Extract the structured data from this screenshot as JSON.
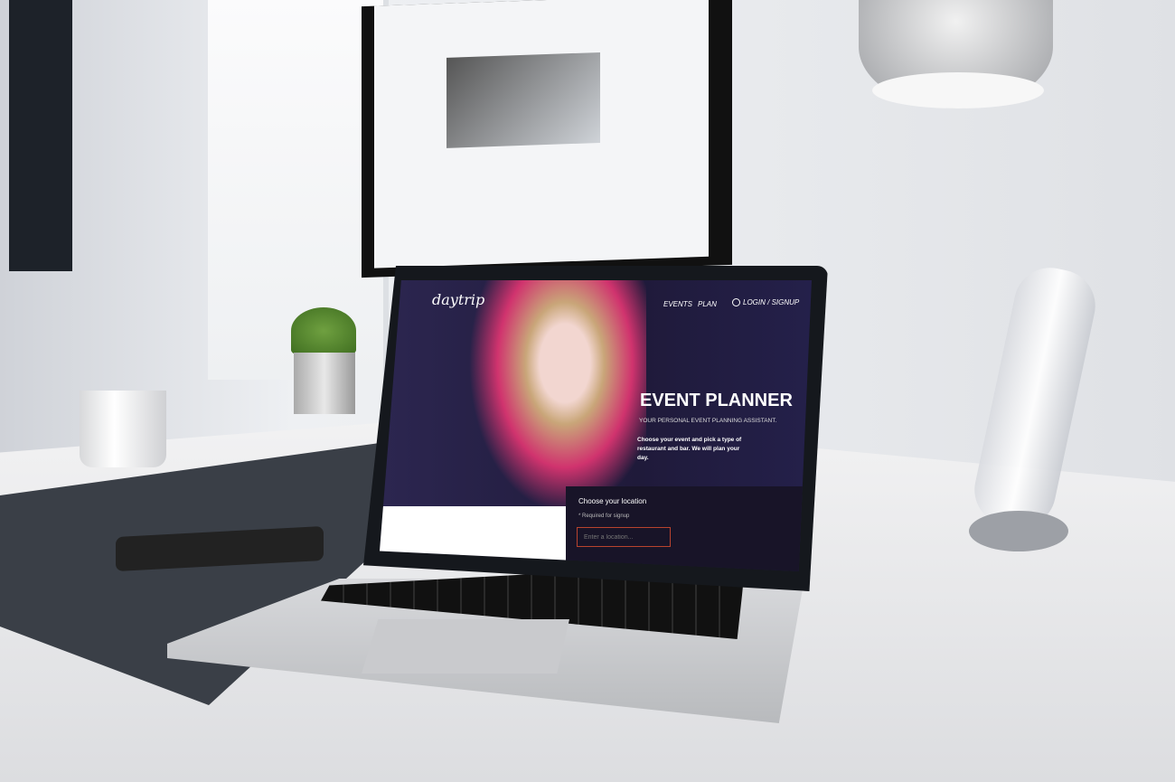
{
  "site": {
    "logo": "daytrip",
    "nav": {
      "events": "EVENTS",
      "plan": "PLAN",
      "login": "LOGIN / SIGNUP"
    },
    "hero": {
      "title": "EVENT PLANNER",
      "subtitle": "YOUR PERSONAL EVENT PLANNING ASSISTANT.",
      "description": "Choose your event and pick a type of restaurant and bar. We will plan your day."
    },
    "location": {
      "title": "Choose your location",
      "required_note": "* Required for signup",
      "placeholder": "Enter a location..."
    },
    "colors": {
      "background": "#221d40",
      "accent": "#b8432e",
      "panel": "#181428"
    },
    "icons": {
      "login": "user-icon"
    }
  }
}
